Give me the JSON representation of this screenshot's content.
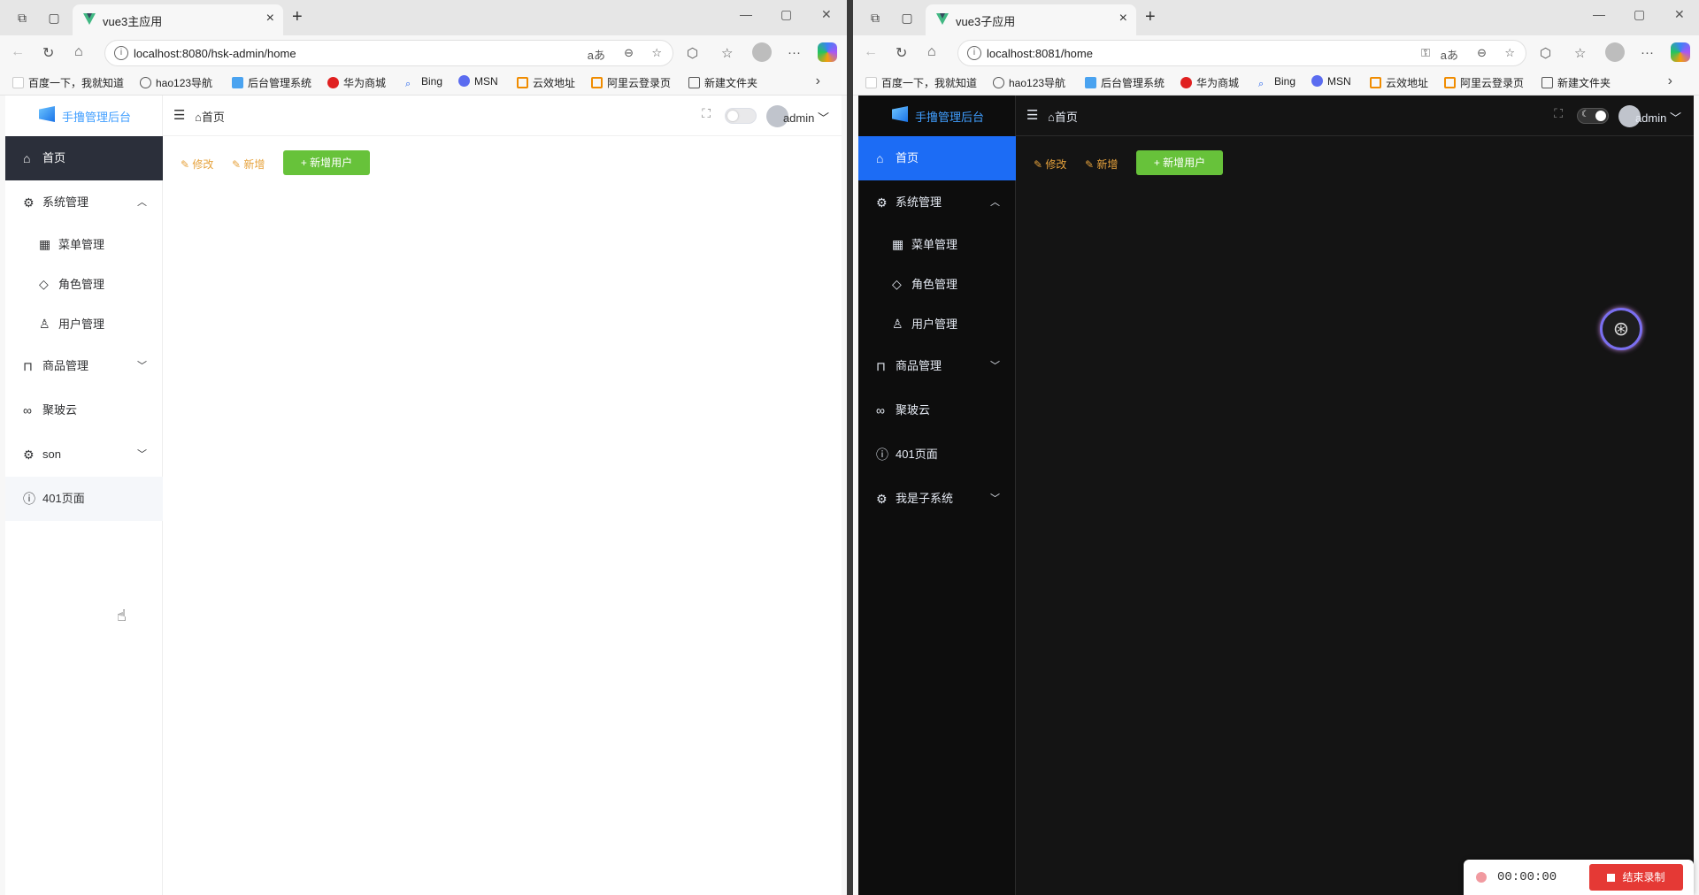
{
  "left": {
    "tab_title": "vue3主应用",
    "url": "localhost:8080/hsk-admin/home",
    "bookmarks": [
      "百度一下，我就知道",
      "hao123导航",
      "后台管理系统",
      "华为商城",
      "Bing",
      "MSN",
      "云效地址",
      "阿里云登录页",
      "新建文件夹"
    ],
    "logo_text": "手撸管理后台",
    "breadcrumb": "首页",
    "user": "admin",
    "menu": {
      "home": "首页",
      "system": "系统管理",
      "menu_mgmt": "菜单管理",
      "role_mgmt": "角色管理",
      "user_mgmt": "用户管理",
      "goods": "商品管理",
      "jupo": "聚玻云",
      "son": "son",
      "p401": "401页面"
    },
    "toolbar": {
      "edit": "修改",
      "add": "新增",
      "add_user": "新增用户"
    }
  },
  "right": {
    "tab_title": "vue3子应用",
    "url": "localhost:8081/home",
    "bookmarks": [
      "百度一下，我就知道",
      "hao123导航",
      "后台管理系统",
      "华为商城",
      "Bing",
      "MSN",
      "云效地址",
      "阿里云登录页",
      "新建文件夹"
    ],
    "logo_text": "手撸管理后台",
    "breadcrumb": "首页",
    "user": "admin",
    "menu": {
      "home": "首页",
      "system": "系统管理",
      "menu_mgmt": "菜单管理",
      "role_mgmt": "角色管理",
      "user_mgmt": "用户管理",
      "goods": "商品管理",
      "jupo": "聚玻云",
      "p401": "401页面",
      "subsystem": "我是子系统"
    },
    "toolbar": {
      "edit": "修改",
      "add": "新增",
      "add_user": "新增用户"
    }
  },
  "recorder": {
    "time": "00:00:00",
    "stop_label": "结束录制"
  },
  "colors": {
    "accent_blue": "#409eff",
    "success_green": "#67c23a",
    "warning_orange": "#e6a23c",
    "dark_active": "#1c6cf5",
    "record_red": "#e53935"
  }
}
